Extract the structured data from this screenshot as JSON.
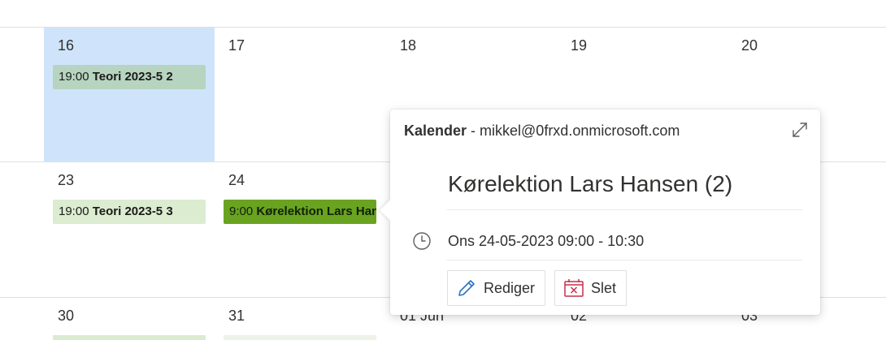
{
  "calendar": {
    "rows": [
      [
        {
          "day": "16",
          "today": true,
          "event": {
            "time": "19:00",
            "title": "Teori 2023-5 2",
            "style": "dark"
          }
        },
        {
          "day": "17"
        },
        {
          "day": "18"
        },
        {
          "day": "19"
        },
        {
          "day": "20"
        }
      ],
      [
        {
          "day": "23",
          "event": {
            "time": "19:00",
            "title": "Teori 2023-5 3",
            "style": "light"
          }
        },
        {
          "day": "24",
          "event": {
            "time": "9:00",
            "title": "Kørelektion Lars Hansen (2)",
            "style": "active"
          }
        },
        {
          "day": ""
        },
        {
          "day": ""
        },
        {
          "day": ""
        }
      ],
      [
        {
          "day": "30"
        },
        {
          "day": "31"
        },
        {
          "day": "01 Jun"
        },
        {
          "day": "02"
        },
        {
          "day": "03"
        }
      ]
    ],
    "colors": {
      "today_bg": "#cfe4fa",
      "event_dark": "#b6d4c0",
      "event_light": "#dbecd0",
      "event_active": "#6aa31f"
    }
  },
  "popup": {
    "calendar_label": "Kalender",
    "account": " - mikkel@0frxd.onmicrosoft.com",
    "title": "Kørelektion Lars Hansen (2)",
    "datetime": "Ons 24-05-2023 09:00 - 10:30",
    "edit_label": "Rediger",
    "delete_label": "Slet",
    "icons": [
      "expand-icon",
      "clock-icon",
      "pencil-icon",
      "delete-calendar-icon"
    ]
  }
}
